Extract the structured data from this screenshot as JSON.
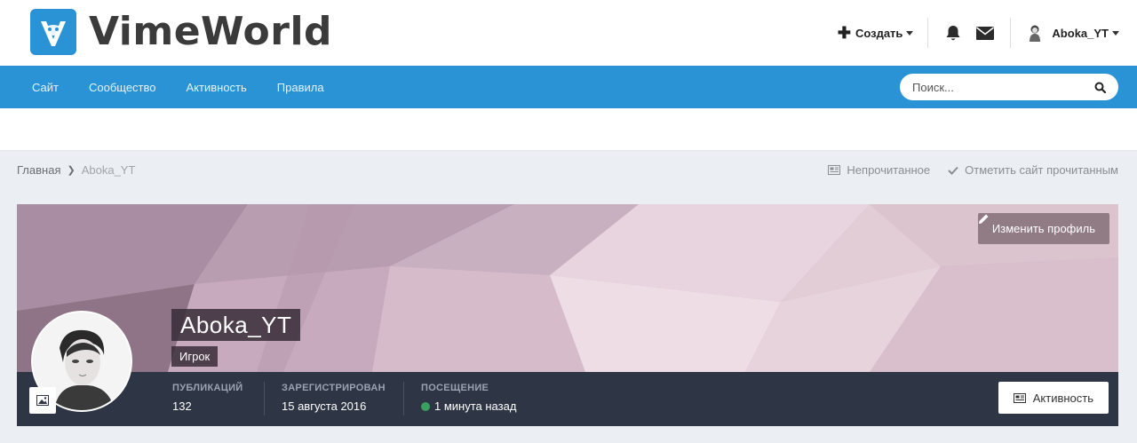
{
  "header": {
    "logo_text": "VimeWorld",
    "create_label": "Создать",
    "username": "Aboka_YT"
  },
  "nav": {
    "items": [
      {
        "label": "Сайт"
      },
      {
        "label": "Сообщество"
      },
      {
        "label": "Активность"
      },
      {
        "label": "Правила"
      }
    ],
    "search_placeholder": "Поиск..."
  },
  "breadcrumb": {
    "home": "Главная",
    "current": "Aboka_YT"
  },
  "crumb_actions": {
    "unread": "Непрочитанное",
    "mark_read": "Отметить сайт прочитанным"
  },
  "profile": {
    "name": "Aboka_YT",
    "group": "Игрок",
    "edit_label": "Изменить профиль",
    "activity_label": "Активность",
    "stats": [
      {
        "label": "ПУБЛИКАЦИЙ",
        "value": "132"
      },
      {
        "label": "ЗАРЕГИСТРИРОВАН",
        "value": "15 августа 2016"
      },
      {
        "label": "ПОСЕЩЕНИЕ",
        "value": "1 минута назад"
      }
    ],
    "online_color": "#3aa05f"
  },
  "colors": {
    "accent": "#2a93d5",
    "stats_bar": "#2e3544",
    "cover": "#c9aebd"
  },
  "icons": [
    "logo-icon",
    "plus-icon",
    "bell-icon",
    "envelope-icon",
    "search-icon",
    "newspaper-icon",
    "check-icon",
    "pencil-icon",
    "image-icon"
  ]
}
